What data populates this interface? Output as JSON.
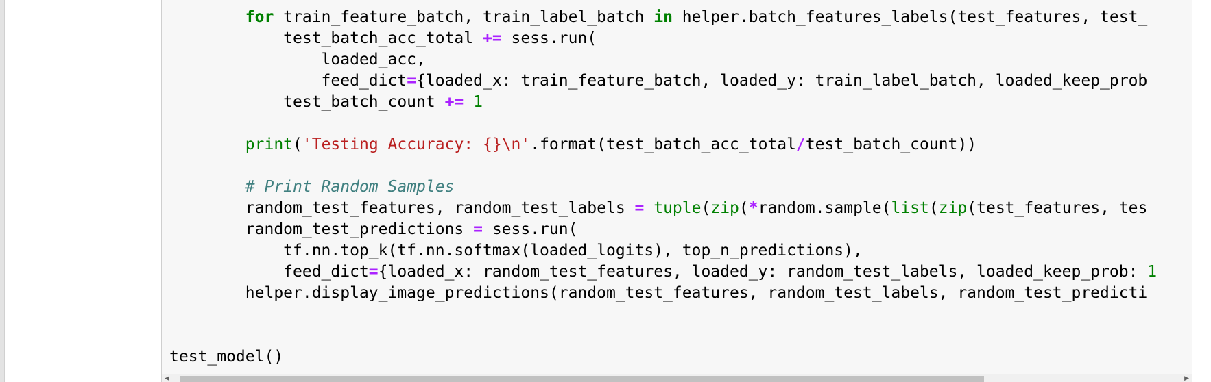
{
  "code_lines": [
    [
      {
        "t": "        "
      },
      {
        "t": "for",
        "c": "kw"
      },
      {
        "t": " train_feature_batch, train_label_batch "
      },
      {
        "t": "in",
        "c": "kw"
      },
      {
        "t": " helper.batch_features_labels(test_features, test_"
      }
    ],
    [
      {
        "t": "            test_batch_acc_total "
      },
      {
        "t": "+=",
        "c": "op"
      },
      {
        "t": " sess.run("
      }
    ],
    [
      {
        "t": "                loaded_acc,"
      }
    ],
    [
      {
        "t": "                feed_dict"
      },
      {
        "t": "=",
        "c": "op"
      },
      {
        "t": "{loaded_x: train_feature_batch, loaded_y: train_label_batch, loaded_keep_prob"
      }
    ],
    [
      {
        "t": "            test_batch_count "
      },
      {
        "t": "+=",
        "c": "op"
      },
      {
        "t": " "
      },
      {
        "t": "1",
        "c": "num"
      }
    ],
    [],
    [
      {
        "t": "        "
      },
      {
        "t": "print",
        "c": "bi"
      },
      {
        "t": "("
      },
      {
        "t": "'Testing Accuracy: {}\\n'",
        "c": "str"
      },
      {
        "t": ".format(test_batch_acc_total"
      },
      {
        "t": "/",
        "c": "op"
      },
      {
        "t": "test_batch_count))"
      }
    ],
    [],
    [
      {
        "t": "        "
      },
      {
        "t": "# Print Random Samples",
        "c": "cm"
      }
    ],
    [
      {
        "t": "        random_test_features, random_test_labels "
      },
      {
        "t": "=",
        "c": "op"
      },
      {
        "t": " "
      },
      {
        "t": "tuple",
        "c": "bi"
      },
      {
        "t": "("
      },
      {
        "t": "zip",
        "c": "bi"
      },
      {
        "t": "("
      },
      {
        "t": "*",
        "c": "op"
      },
      {
        "t": "random.sample("
      },
      {
        "t": "list",
        "c": "bi"
      },
      {
        "t": "("
      },
      {
        "t": "zip",
        "c": "bi"
      },
      {
        "t": "(test_features, tes"
      }
    ],
    [
      {
        "t": "        random_test_predictions "
      },
      {
        "t": "=",
        "c": "op"
      },
      {
        "t": " sess.run("
      }
    ],
    [
      {
        "t": "            tf.nn.top_k(tf.nn.softmax(loaded_logits), top_n_predictions),"
      }
    ],
    [
      {
        "t": "            feed_dict"
      },
      {
        "t": "=",
        "c": "op"
      },
      {
        "t": "{loaded_x: random_test_features, loaded_y: random_test_labels, loaded_keep_prob: "
      },
      {
        "t": "1",
        "c": "num"
      }
    ],
    [
      {
        "t": "        helper.display_image_predictions(random_test_features, random_test_labels, random_test_predicti"
      }
    ],
    [],
    [],
    [
      {
        "t": "test_model()"
      }
    ]
  ],
  "colors": {
    "keyword": "#008000",
    "operator": "#aa22ff",
    "string": "#ba2121",
    "comment": "#408080",
    "cell_background": "#f7f7f7"
  },
  "scrollbar": {
    "left_arrow_icon": "chevron-left-icon",
    "right_arrow_icon": "chevron-right-icon"
  }
}
